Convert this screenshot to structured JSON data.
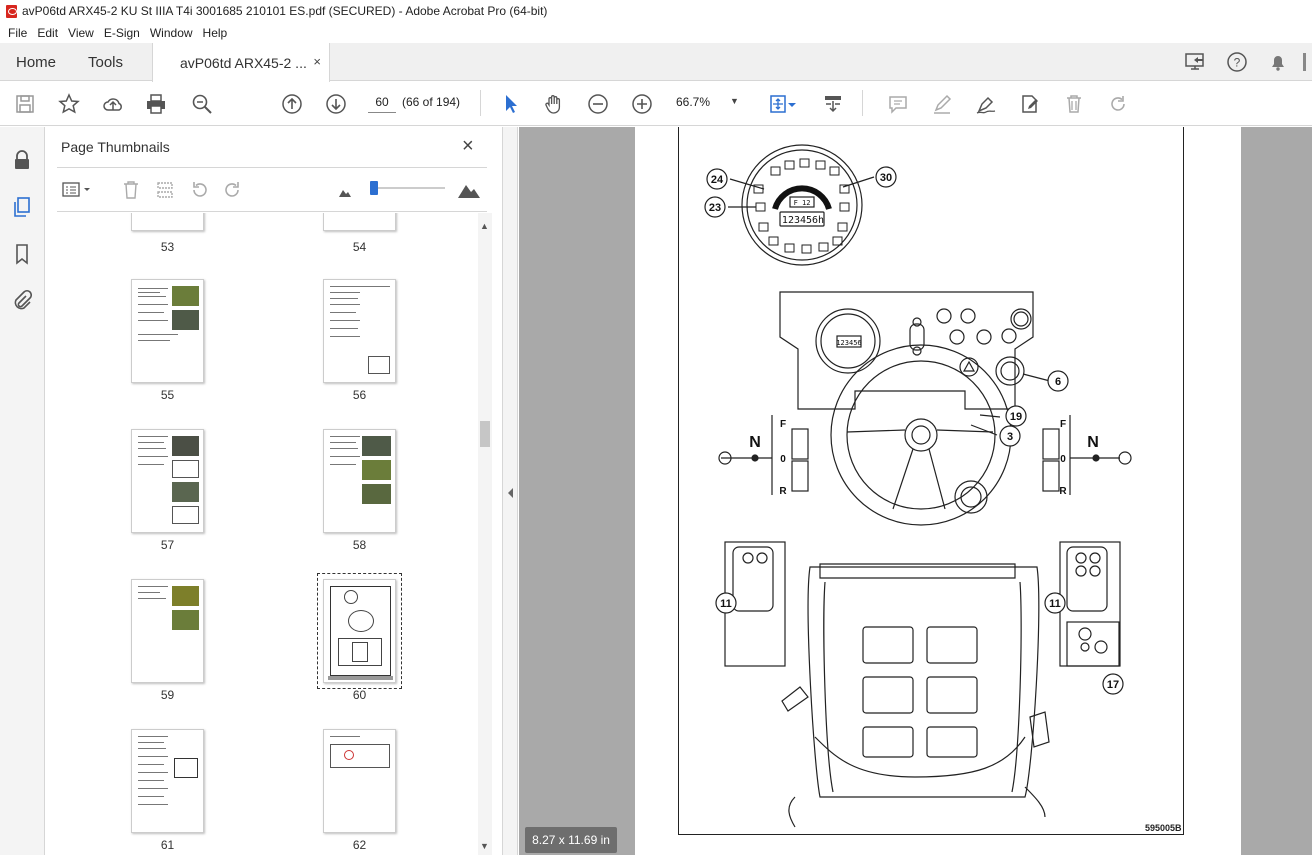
{
  "window": {
    "title": "avP06td ARX45-2 KU St IIIA T4i 3001685 210101 ES.pdf (SECURED) - Adobe Acrobat Pro (64-bit)"
  },
  "menu": [
    "File",
    "Edit",
    "View",
    "E-Sign",
    "Window",
    "Help"
  ],
  "tabs": {
    "home": "Home",
    "tools": "Tools",
    "document": "avP06td ARX45-2 ...",
    "close": "×"
  },
  "toolbar": {
    "page_input": "60",
    "page_count": "(66 of 194)",
    "zoom": "66.7%"
  },
  "panel": {
    "title": "Page Thumbnails",
    "close": "×",
    "thumbnails": [
      {
        "label": "53"
      },
      {
        "label": "54"
      },
      {
        "label": "55"
      },
      {
        "label": "56"
      },
      {
        "label": "57"
      },
      {
        "label": "58"
      },
      {
        "label": "59"
      },
      {
        "label": "60",
        "selected": true
      },
      {
        "label": "61"
      },
      {
        "label": "62"
      }
    ]
  },
  "viewer": {
    "page_size": "8.27 x 11.69 in",
    "doc_id": "595005B",
    "callouts": [
      "24",
      "30",
      "23",
      "6",
      "19",
      "3",
      "11",
      "11",
      "17"
    ],
    "gauge": {
      "display": "123456h",
      "gear": "F 12"
    },
    "dash_display": "123456",
    "shifter_left": {
      "n": "N",
      "f": "F",
      "zero": "0",
      "r": "R"
    },
    "shifter_right": {
      "n": "N",
      "f": "F",
      "zero": "0",
      "r": "R"
    }
  },
  "colors": {
    "accent": "#2c6fd1",
    "pdf_icon": "#d7261e",
    "viewer_bg": "#a9a9a9"
  }
}
